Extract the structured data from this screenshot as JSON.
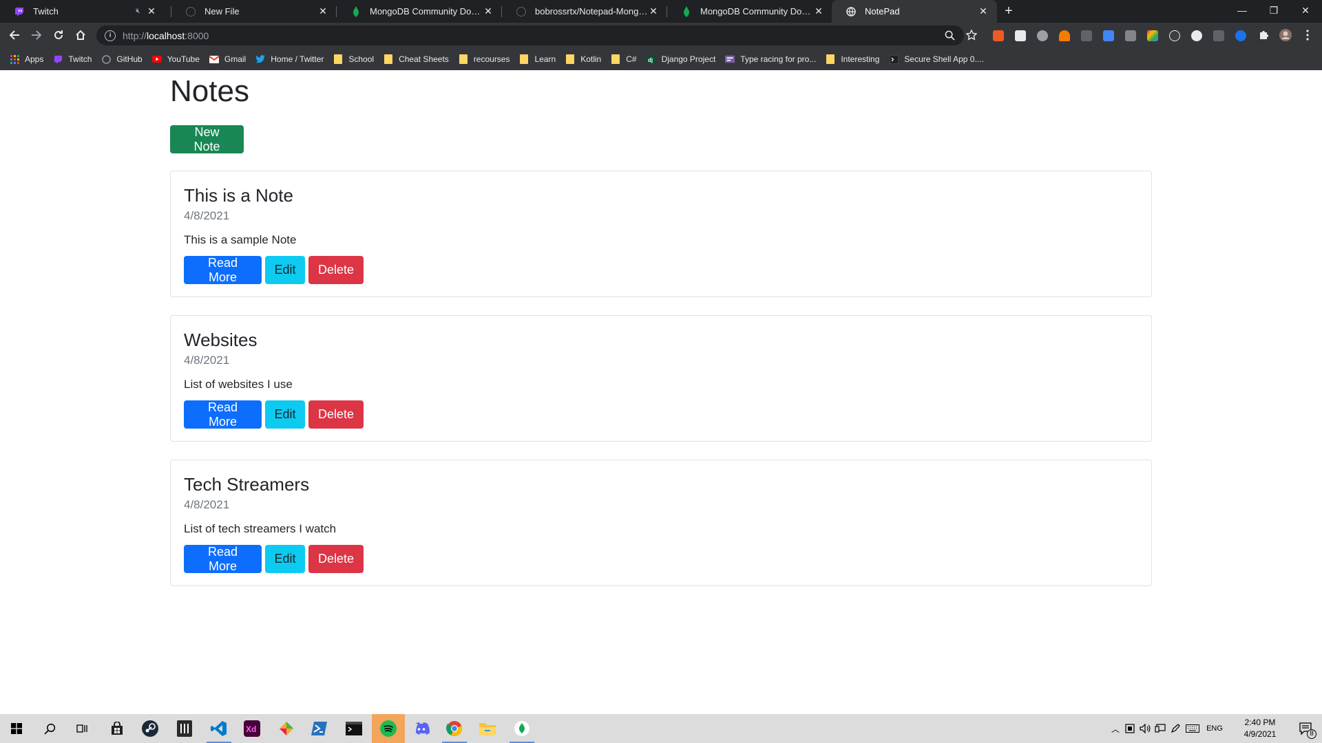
{
  "browser": {
    "tabs": [
      {
        "title": "Twitch",
        "icon": "twitch-icon",
        "muted": true
      },
      {
        "title": "New File",
        "icon": "github-icon"
      },
      {
        "title": "MongoDB Community Download",
        "icon": "mongodb-icon"
      },
      {
        "title": "bobrossrtx/Notepad-MongoDB-Django",
        "icon": "github-icon"
      },
      {
        "title": "MongoDB Community Download",
        "icon": "mongodb-icon"
      },
      {
        "title": "NotePad",
        "icon": "globe-icon",
        "active": true
      }
    ],
    "url": {
      "protocol": "http://",
      "host": "localhost",
      "port": ":8000"
    },
    "bookmarks": [
      {
        "label": "Apps",
        "icon": "apps-grid-icon"
      },
      {
        "label": "Twitch",
        "icon": "twitch-icon"
      },
      {
        "label": "GitHub",
        "icon": "github-icon"
      },
      {
        "label": "YouTube",
        "icon": "youtube-icon"
      },
      {
        "label": "Gmail",
        "icon": "gmail-icon"
      },
      {
        "label": "Home / Twitter",
        "icon": "twitter-icon"
      },
      {
        "label": "School",
        "icon": "folder-icon"
      },
      {
        "label": "Cheat Sheets",
        "icon": "folder-icon"
      },
      {
        "label": "recourses",
        "icon": "folder-icon"
      },
      {
        "label": "Learn",
        "icon": "folder-icon"
      },
      {
        "label": "Kotlin",
        "icon": "folder-icon"
      },
      {
        "label": "C#",
        "icon": "folder-icon"
      },
      {
        "label": "Django Project",
        "icon": "django-icon"
      },
      {
        "label": "Type racing for pro...",
        "icon": "typeracer-icon"
      },
      {
        "label": "Interesting",
        "icon": "folder-icon"
      },
      {
        "label": "Secure Shell App 0....",
        "icon": "terminal-icon"
      }
    ]
  },
  "page": {
    "heading": "Notes",
    "new_note_label": "New Note",
    "notes": [
      {
        "title": "This is a Note",
        "date": "4/8/2021",
        "body": "This is a sample Note"
      },
      {
        "title": "Websites",
        "date": "4/8/2021",
        "body": "List of websites I use"
      },
      {
        "title": "Tech Streamers",
        "date": "4/8/2021",
        "body": "List of tech streamers I watch"
      }
    ],
    "actions": {
      "read_more": "Read More",
      "edit": "Edit",
      "delete": "Delete"
    }
  },
  "taskbar": {
    "language": "ENG",
    "time": "2:40 PM",
    "date": "4/9/2021",
    "notification_count": "8"
  },
  "colors": {
    "success": "#198754",
    "primary": "#0d6efd",
    "info": "#0dcaf0",
    "danger": "#dc3545"
  }
}
